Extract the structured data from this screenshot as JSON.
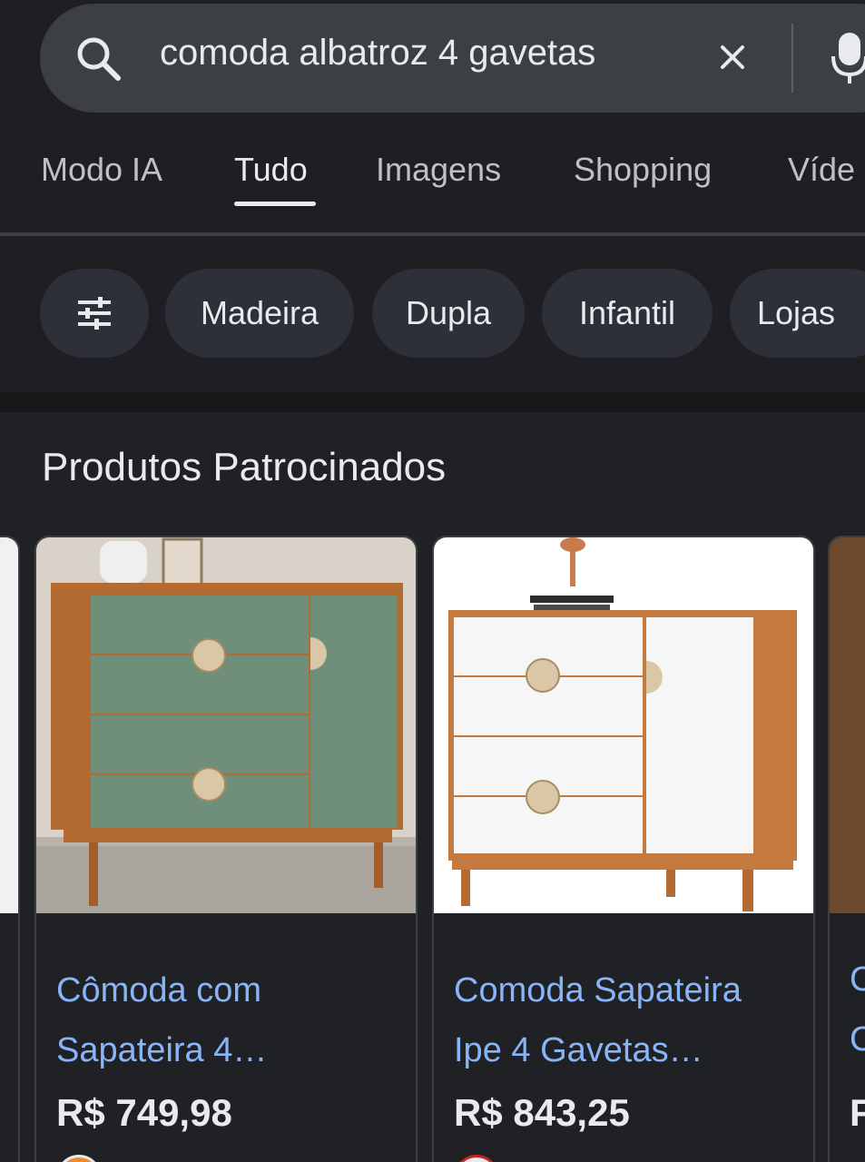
{
  "search": {
    "query": "comoda albatroz 4 gavetas"
  },
  "tabs": [
    {
      "label": "Modo IA"
    },
    {
      "label": "Tudo"
    },
    {
      "label": "Imagens"
    },
    {
      "label": "Shopping"
    },
    {
      "label": "Víde"
    }
  ],
  "chips": [
    {
      "label": "Madeira"
    },
    {
      "label": "Dupla"
    },
    {
      "label": "Infantil"
    },
    {
      "label": "Lojas"
    }
  ],
  "section": {
    "title": "Produtos Patrocinados"
  },
  "products": [
    {
      "title": "Cômoda com Sapateira 4…",
      "price": "R$ 749,98"
    },
    {
      "title": "Comoda Sapateira Ipe 4 Gavetas…",
      "price": "R$ 843,25"
    }
  ],
  "partial_product": {
    "title_line1": "C",
    "title_line2": "C",
    "price": "F"
  },
  "colors": {
    "background": "#202124",
    "link": "#8ab4f8",
    "chip": "#2d3039",
    "search_pill": "#3c3f43"
  }
}
